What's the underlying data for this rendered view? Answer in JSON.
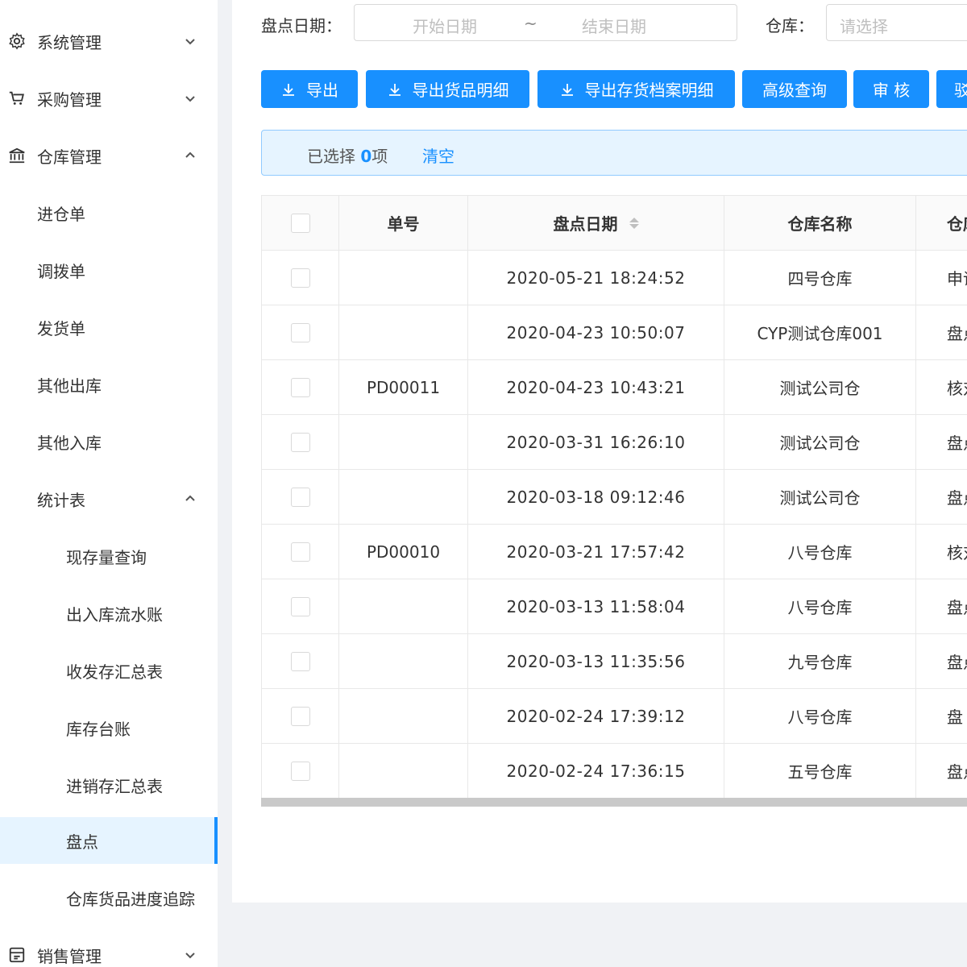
{
  "sidebar": {
    "items": [
      {
        "label": "系统管理",
        "icon": "gear-icon",
        "chevron": "down"
      },
      {
        "label": "采购管理",
        "icon": "cart-icon",
        "chevron": "down"
      },
      {
        "label": "仓库管理",
        "icon": "bank-icon",
        "chevron": "up"
      },
      {
        "label": "进仓单"
      },
      {
        "label": "调拨单"
      },
      {
        "label": "发货单"
      },
      {
        "label": "其他出库"
      },
      {
        "label": "其他入库"
      },
      {
        "label": "统计表",
        "chevron": "up"
      },
      {
        "label": "现存量查询"
      },
      {
        "label": "出入库流水账"
      },
      {
        "label": "收发存汇总表"
      },
      {
        "label": "库存台账"
      },
      {
        "label": "进销存汇总表"
      },
      {
        "label": "盘点",
        "active": true
      },
      {
        "label": "仓库货品进度追踪"
      },
      {
        "label": "销售管理",
        "icon": "invoice-icon",
        "chevron": "down"
      }
    ]
  },
  "filters": {
    "date_label": "盘点日期：",
    "start_placeholder": "开始日期",
    "range_sep": "~",
    "end_placeholder": "结束日期",
    "warehouse_label": "仓库：",
    "warehouse_placeholder": "请选择"
  },
  "toolbar": {
    "export": "导出",
    "export_goods_detail": "导出货品明细",
    "export_stock_archive_detail": "导出存货档案明细",
    "advanced_query": "高级查询",
    "audit": "审 核",
    "reject_partial": "驳"
  },
  "selection": {
    "prefix": "已选择",
    "count": "0",
    "suffix": "项",
    "clear": "清空"
  },
  "table": {
    "columns": [
      "单号",
      "盘点日期",
      "仓库名称",
      "仓库"
    ],
    "rows": [
      {
        "no": "",
        "date": "2020-05-21 18:24:52",
        "warehouse": "四号仓库",
        "extra": "申请"
      },
      {
        "no": "",
        "date": "2020-04-23 10:50:07",
        "warehouse": "CYP测试仓库001",
        "extra": "盘点"
      },
      {
        "no": "PD00011",
        "date": "2020-04-23 10:43:21",
        "warehouse": "测试公司仓",
        "extra": "核对"
      },
      {
        "no": "",
        "date": "2020-03-31 16:26:10",
        "warehouse": "测试公司仓",
        "extra": "盘点"
      },
      {
        "no": "",
        "date": "2020-03-18 09:12:46",
        "warehouse": "测试公司仓",
        "extra": "盘点"
      },
      {
        "no": "PD00010",
        "date": "2020-03-21 17:57:42",
        "warehouse": "八号仓库",
        "extra": "核对"
      },
      {
        "no": "",
        "date": "2020-03-13 11:58:04",
        "warehouse": "八号仓库",
        "extra": "盘点"
      },
      {
        "no": "",
        "date": "2020-03-13 11:35:56",
        "warehouse": "九号仓库",
        "extra": "盘点"
      },
      {
        "no": "",
        "date": "2020-02-24 17:39:12",
        "warehouse": "八号仓库",
        "extra": "盘"
      },
      {
        "no": "",
        "date": "2020-02-24 17:36:15",
        "warehouse": "五号仓库",
        "extra": "盘点"
      }
    ]
  },
  "colors": {
    "primary": "#1890ff",
    "active_bg": "#e6f4ff",
    "page_bg": "#f0f2f5"
  }
}
